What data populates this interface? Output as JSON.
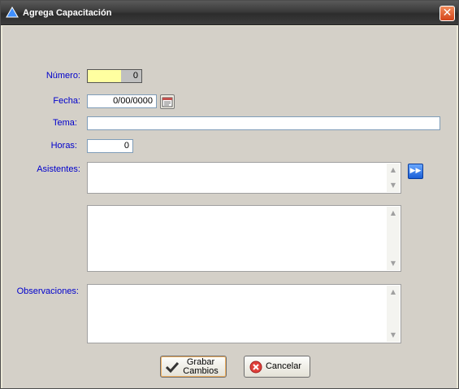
{
  "window": {
    "title": "Agrega Capacitación",
    "close_label": "✕"
  },
  "form": {
    "numero": {
      "label": "Número:",
      "value": "0"
    },
    "fecha": {
      "label": "Fecha:",
      "value": "0/00/0000"
    },
    "tema": {
      "label": "Tema:",
      "value": ""
    },
    "horas": {
      "label": "Horas:",
      "value": "0"
    },
    "asistentes": {
      "label": "Asistentes:"
    },
    "observaciones": {
      "label": "Observaciones:"
    }
  },
  "buttons": {
    "grabar_line1": "Grabar",
    "grabar_line2": "Cambios",
    "cancelar": "Cancelar"
  },
  "icons": {
    "window_icon": "triangle-icon",
    "calendar": "calendar-icon",
    "add_assistants": "fast-forward-icon",
    "save": "checkmark-icon",
    "cancel": "cancel-icon"
  },
  "colors": {
    "label": "#0000cc",
    "numero_highlight": "#ffffa0",
    "titlebar": "#3a3a3a",
    "close": "#d4451a"
  }
}
